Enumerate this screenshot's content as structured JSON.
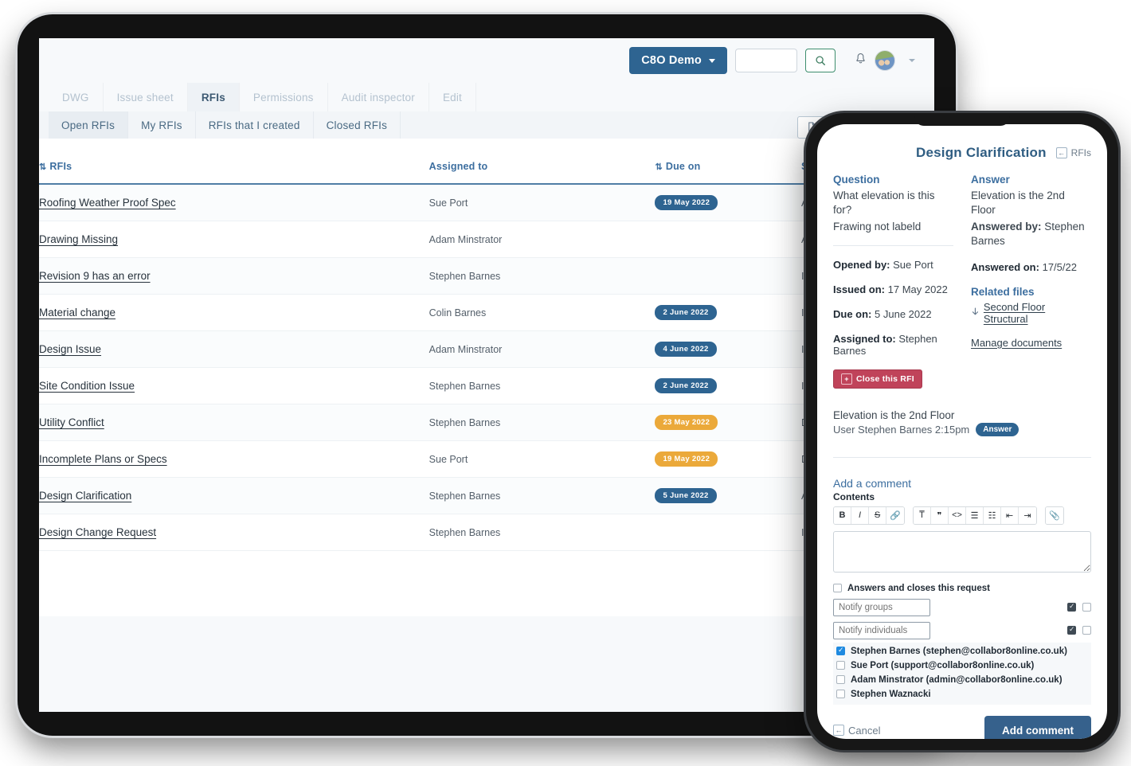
{
  "header": {
    "project_button": "C8O Demo",
    "search_placeholder": "",
    "search_value": ""
  },
  "module_tabs": [
    {
      "label": "DWG",
      "active": false
    },
    {
      "label": "Issue sheet",
      "active": false
    },
    {
      "label": "RFIs",
      "active": true
    },
    {
      "label": "Permissions",
      "active": false
    },
    {
      "label": "Audit inspector",
      "active": false
    },
    {
      "label": "Edit",
      "active": false
    }
  ],
  "sub_tabs": [
    {
      "label": "Open RFIs",
      "active": true
    },
    {
      "label": "My RFIs",
      "active": false
    },
    {
      "label": "RFIs that I created",
      "active": false
    },
    {
      "label": "Closed RFIs",
      "active": false
    }
  ],
  "table": {
    "columns": [
      "RFIs",
      "Assigned to",
      "Due on",
      "Status"
    ],
    "rows": [
      {
        "name": "Roofing Weather Proof Spec",
        "assigned": "Sue Port",
        "due": "19 May 2022",
        "due_color": "blue",
        "status": "Answered"
      },
      {
        "name": "Drawing Missing",
        "assigned": "Adam Minstrator",
        "due": "",
        "due_color": "",
        "status": "Answered"
      },
      {
        "name": "Revision 9 has an error",
        "assigned": "Stephen Barnes",
        "due": "",
        "due_color": "",
        "status": "In progress"
      },
      {
        "name": "Material change",
        "assigned": "Colin Barnes",
        "due": "2 June 2022",
        "due_color": "blue",
        "status": "In progress"
      },
      {
        "name": "Design Issue",
        "assigned": "Adam Minstrator",
        "due": "4 June 2022",
        "due_color": "blue",
        "status": "In progress"
      },
      {
        "name": "Site Condition Issue",
        "assigned": "Stephen Barnes",
        "due": "2 June 2022",
        "due_color": "blue",
        "status": "In progress"
      },
      {
        "name": "Utility Conflict",
        "assigned": "Stephen Barnes",
        "due": "23 May 2022",
        "due_color": "amber",
        "status": "Due"
      },
      {
        "name": "Incomplete Plans or Specs",
        "assigned": "Sue Port",
        "due": "19 May 2022",
        "due_color": "amber",
        "status": "Due"
      },
      {
        "name": "Design Clarification",
        "assigned": "Stephen Barnes",
        "due": "5 June 2022",
        "due_color": "blue",
        "status": "Answered"
      },
      {
        "name": "Design Change Request",
        "assigned": "Stephen Barnes",
        "due": "",
        "due_color": "",
        "status": "In progress"
      }
    ]
  },
  "phone": {
    "title": "Design Clarification",
    "back_label": "RFIs",
    "question_heading": "Question",
    "question_line1": "What elevation is this for?",
    "question_line2": "Frawing not labeld",
    "answer_heading": "Answer",
    "answer_text": "Elevation is the 2nd Floor",
    "answered_by_label": "Answered by:",
    "answered_by_value": "Stephen Barnes",
    "answered_on_label": "Answered on:",
    "answered_on_value": "17/5/22",
    "related_files_heading": "Related files",
    "related_file": "Second Floor Structural",
    "manage_documents": "Manage documents",
    "opened_by_label": "Opened by:",
    "opened_by_value": "Sue Port",
    "issued_on_label": "Issued on:",
    "issued_on_value": "17 May 2022",
    "due_on_label": "Due on:",
    "due_on_value": "5 June 2022",
    "assigned_to_label": "Assigned to:",
    "assigned_to_value": "Stephen Barnes",
    "close_rfi": "Close this RFI",
    "comment_text": "Elevation is the 2nd Floor",
    "comment_meta": "User Stephen Barnes 2:15pm",
    "comment_tag": "Answer",
    "add_comment_heading": "Add a comment",
    "contents_label": "Contents",
    "editor_value": "",
    "answers_closes_label": "Answers and closes this request",
    "notify_groups_placeholder": "Notify groups",
    "notify_individuals_placeholder": "Notify individuals",
    "notify_groups_value": "",
    "notify_individuals_value": "",
    "people": [
      {
        "label": "Stephen Barnes (stephen@collabor8online.co.uk)",
        "checked": true
      },
      {
        "label": "Sue Port (support@collabor8online.co.uk)",
        "checked": false
      },
      {
        "label": "Adam Minstrator (admin@collabor8online.co.uk)",
        "checked": false
      },
      {
        "label": "Stephen Waznacki",
        "checked": false
      }
    ],
    "cancel_label": "Cancel",
    "add_comment_button": "Add comment"
  },
  "colors": {
    "brand_blue": "#2e6491",
    "accent_green": "#3e8e6e",
    "pill_blue": "#2e6491",
    "pill_amber": "#eba93a",
    "danger_red": "#c0435a"
  }
}
